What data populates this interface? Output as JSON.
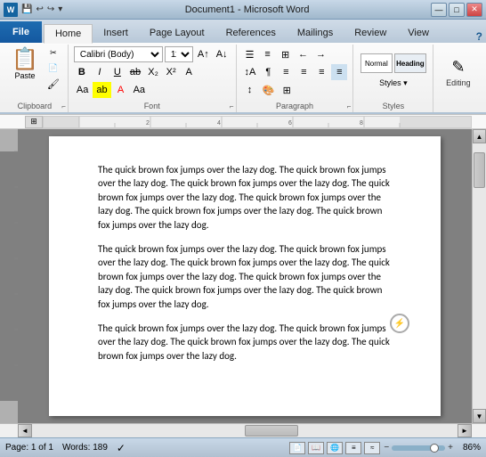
{
  "titlebar": {
    "title": "Document1 - Microsoft Word",
    "controls": [
      "minimize",
      "maximize",
      "close"
    ],
    "minimize_label": "—",
    "maximize_label": "□",
    "close_label": "✕"
  },
  "tabs": [
    {
      "label": "File",
      "active": false
    },
    {
      "label": "Home",
      "active": true
    },
    {
      "label": "Insert",
      "active": false
    },
    {
      "label": "Page Layout",
      "active": false
    },
    {
      "label": "References",
      "active": false
    },
    {
      "label": "Mailings",
      "active": false
    },
    {
      "label": "Review",
      "active": false
    },
    {
      "label": "View",
      "active": false
    }
  ],
  "help_icon": "?",
  "ribbon": {
    "groups": [
      {
        "name": "Clipboard",
        "label": "Clipboard"
      },
      {
        "name": "Font",
        "label": "Font"
      },
      {
        "name": "Paragraph",
        "label": "Paragraph"
      },
      {
        "name": "Styles",
        "label": "Styles"
      },
      {
        "name": "Editing",
        "label": "Editing"
      }
    ],
    "font_name": "Calibri (Body)",
    "font_size": "11",
    "paste_label": "Paste",
    "styles_label": "Styles",
    "editing_label": "Editing"
  },
  "document": {
    "paragraphs": [
      "The quick brown fox jumps over the lazy dog. The quick brown fox jumps over the lazy dog. The quick brown fox jumps over the lazy dog. The quick brown fox jumps over the lazy dog. The quick brown fox jumps over the lazy dog. The quick brown fox jumps over the lazy dog. The quick brown fox jumps over the lazy dog.",
      "The quick brown fox jumps over the lazy dog. The quick brown fox jumps over the lazy dog. The quick brown fox jumps over the lazy dog. The quick brown fox jumps over the lazy dog. The quick brown fox jumps over the lazy dog. The quick brown fox jumps over the lazy dog. The quick brown fox jumps over the lazy dog.",
      "The quick brown fox jumps over the lazy dog. The quick brown fox jumps over the lazy dog. The quick brown fox jumps over the lazy dog. The quick brown fox jumps over the lazy dog."
    ]
  },
  "statusbar": {
    "page_info": "Page: 1 of 1",
    "words_label": "Words: 189",
    "zoom_level": "86%",
    "zoom_minus": "−",
    "zoom_plus": "+"
  }
}
